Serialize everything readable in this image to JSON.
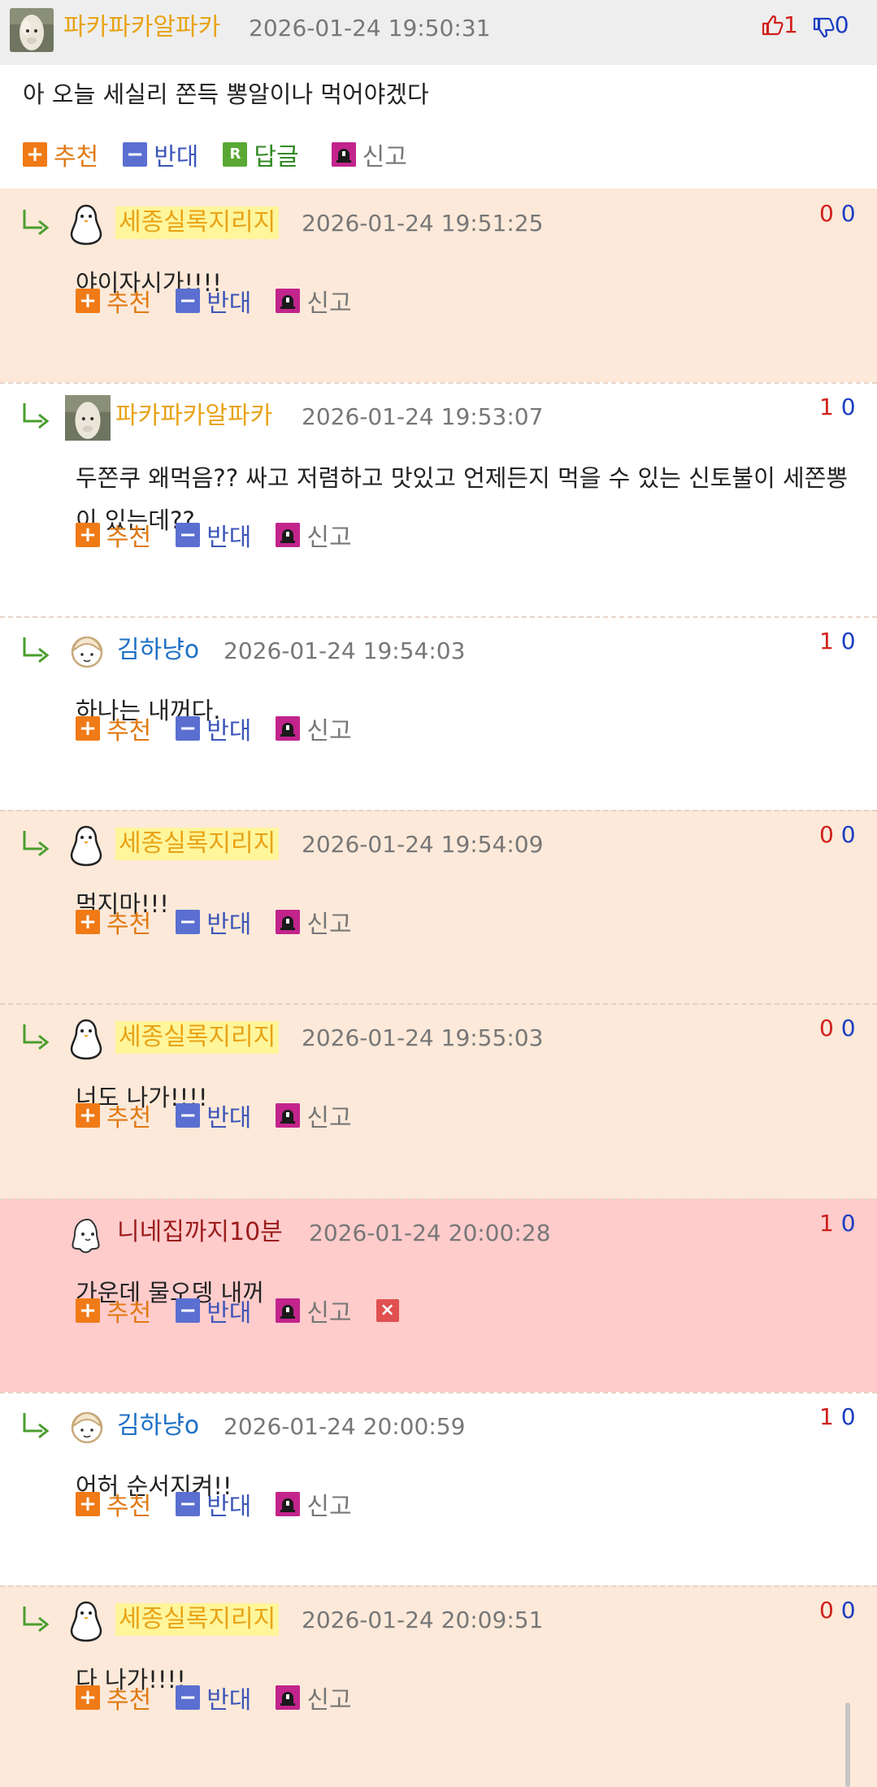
{
  "post": {
    "author": "파카파카알파카",
    "timestamp": "2026-01-24 19:50:31",
    "likes": "1",
    "dislikes": "0",
    "text": "아 오늘 세실리 쫀득 뽕알이나 먹어야겠다",
    "actions": {
      "recommend": "추천",
      "oppose": "반대",
      "reply": "답글",
      "report": "신고"
    },
    "reply_icon_letter": "R"
  },
  "labels": {
    "recommend": "추천",
    "oppose": "반대",
    "report": "신고"
  },
  "comments": [
    {
      "author": "세종실록지리지",
      "timestamp": "2026-01-24 19:51:25",
      "up": "0",
      "down": "0",
      "text": "야이자시가!!!!"
    },
    {
      "author": "파카파카알파카",
      "timestamp": "2026-01-24 19:53:07",
      "up": "1",
      "down": "0",
      "text": "두쫀쿠 왜먹음?? 싸고 저렴하고 맛있고 언제든지 먹을 수 있는 신토불이 세쫀뽕이 있는데??"
    },
    {
      "author": "김하냥o",
      "timestamp": "2026-01-24 19:54:03",
      "up": "1",
      "down": "0",
      "text": "하나는 내꺼다."
    },
    {
      "author": "세종실록지리지",
      "timestamp": "2026-01-24 19:54:09",
      "up": "0",
      "down": "0",
      "text": "먹지마!!!"
    },
    {
      "author": "세종실록지리지",
      "timestamp": "2026-01-24 19:55:03",
      "up": "0",
      "down": "0",
      "text": "너도 나가!!!!"
    },
    {
      "author": "니네집까지10분",
      "timestamp": "2026-01-24 20:00:28",
      "up": "1",
      "down": "0",
      "text": "가운데 물오뎅 내꺼"
    },
    {
      "author": "김하냥o",
      "timestamp": "2026-01-24 20:00:59",
      "up": "1",
      "down": "0",
      "text": "어허 순서지켜!!"
    },
    {
      "author": "세종실록지리지",
      "timestamp": "2026-01-24 20:09:51",
      "up": "0",
      "down": "0",
      "text": "다 나가!!!!"
    }
  ],
  "icons": {
    "like": "thumbs-up-icon",
    "dislike": "thumbs-down-icon",
    "reply_arrow": "reply-arrow-icon",
    "delete": "delete-icon"
  },
  "colors": {
    "recommend": "#f07a16",
    "oppose": "#5a6fd0",
    "reply": "#5aa834",
    "report": "#c2248c",
    "vote_up": "#d0201c",
    "vote_down": "#1b3ec2"
  }
}
